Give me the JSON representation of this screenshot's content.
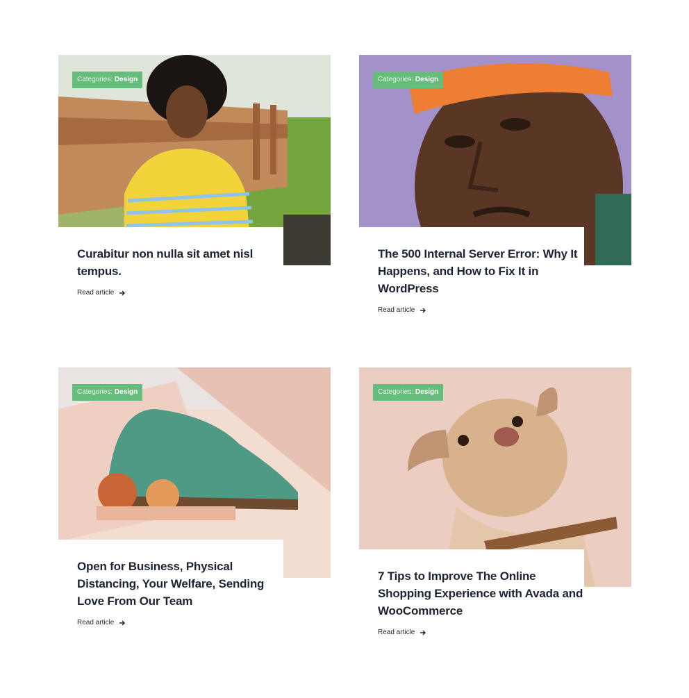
{
  "posts": [
    {
      "category_label": "Categories:",
      "category": "Design",
      "title": "Curabitur non nulla sit amet nisl tempus.",
      "read_more": "Read article"
    },
    {
      "category_label": "Categories:",
      "category": "Design",
      "title": "The 500 Internal Server Error: Why It Happens, and How to Fix It in WordPress",
      "read_more": "Read article"
    },
    {
      "category_label": "Categories:",
      "category": "Design",
      "title": "Open for Business, Physical Distancing, Your Welfare, Sending Love From Our Team",
      "read_more": "Read article"
    },
    {
      "category_label": "Categories:",
      "category": "Design",
      "title": "7 Tips to Improve The Online Shopping Experience with Avada and WooCommerce",
      "read_more": "Read article"
    }
  ],
  "colors": {
    "badge": "#65bc7b",
    "title": "#1d2433"
  },
  "icons": {
    "read_more": "arrow-right-icon"
  }
}
